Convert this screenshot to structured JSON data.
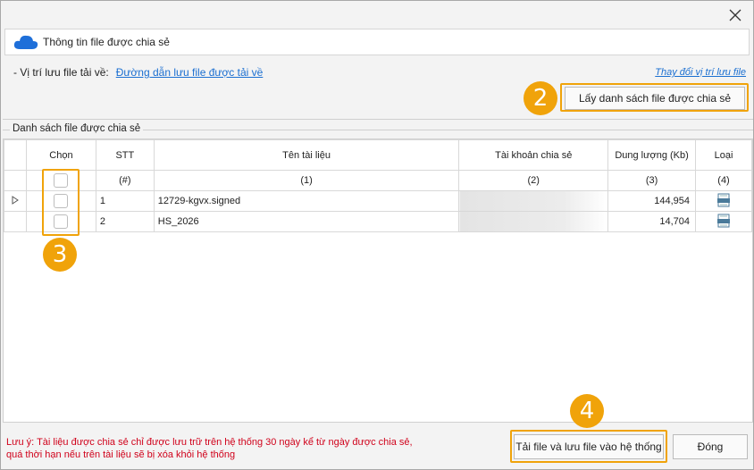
{
  "window": {
    "close_glyph": "✕"
  },
  "header": {
    "title": "Thông tin file được chia sẻ",
    "icon": "cloud-icon"
  },
  "path": {
    "label": "- Vị trí lưu file tải về:",
    "link": "Đường dẫn lưu file được tải về"
  },
  "change_link": "Thay đổi vị trí lưu file",
  "get_list_button": "Lấy danh sách file được chia sẻ",
  "group_title": "Danh sách file được chia sẻ",
  "table": {
    "headers": [
      "Chọn",
      "STT",
      "Tên tài liệu",
      "Tài khoản chia sẻ",
      "Dung lượng (Kb)",
      "Loại"
    ],
    "subheaders": [
      "",
      "(#)",
      "(1)",
      "(2)",
      "(3)",
      "(4)"
    ],
    "rows": [
      {
        "stt": "1",
        "name": "12729-kgvx.signed",
        "size": "144,954",
        "type_icon": "doc-file-icon"
      },
      {
        "stt": "2",
        "name": "HS_2026",
        "size": "14,704",
        "type_icon": "doc-file-icon"
      }
    ]
  },
  "badges": [
    "2",
    "3",
    "4"
  ],
  "footer": {
    "note_line1": "Lưu ý: Tài liệu được chia sẻ chỉ được lưu trữ trên hệ thống 30 ngày kể từ ngày được chia sẻ,",
    "note_line2": "quá thời hạn nếu trên tài liệu sẽ bị xóa khỏi hệ thống",
    "save_button": "Tải file và lưu file vào hệ thống",
    "close_button": "Đóng"
  },
  "colors": {
    "accent": "#f0a30a",
    "link": "#1b6fd1",
    "note": "#d0021b",
    "cloud": "#1e6fd9"
  }
}
